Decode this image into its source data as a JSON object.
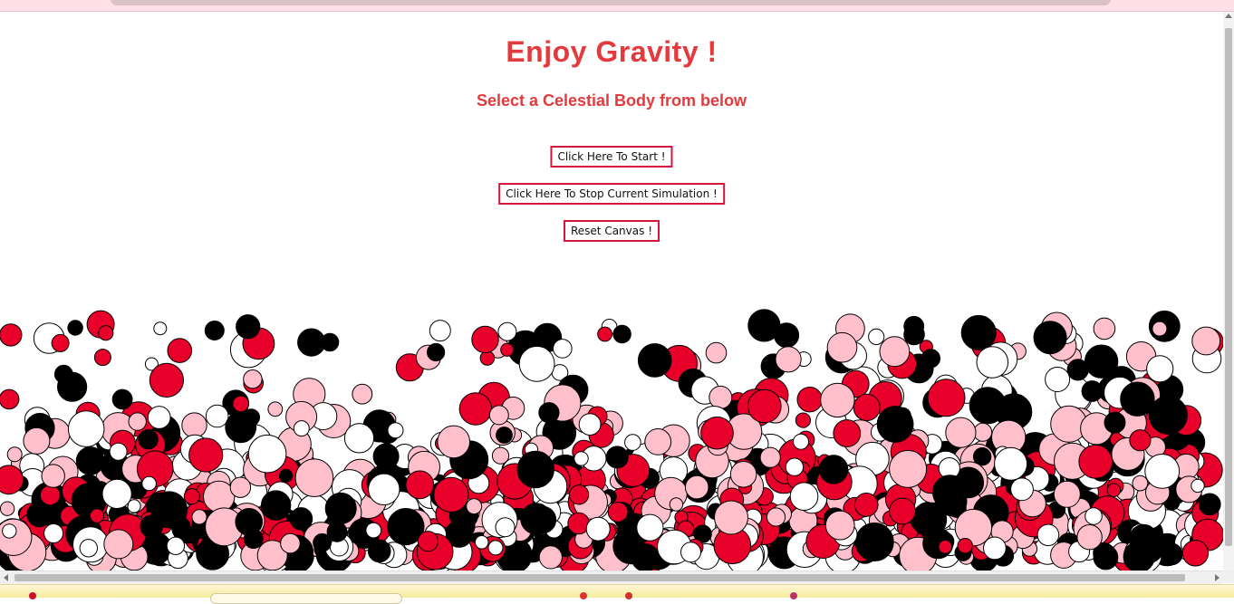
{
  "page": {
    "title": "Enjoy Gravity !",
    "subtitle": "Select a Celestial Body from below"
  },
  "buttons": {
    "start_label": "Click Here To Start !",
    "stop_label": "Click Here To Stop Current Simulation !",
    "reset_label": "Reset Canvas !"
  },
  "colors": {
    "heading": "#e53a3d",
    "button_border": "#d4163a",
    "body_red": "#e8002a",
    "body_pink": "#ffc0cb",
    "body_black": "#000000",
    "body_white": "#ffffff"
  },
  "simulation": {
    "body_colors": [
      "#e8002a",
      "#ffc0cb",
      "#000000",
      "#ffffff"
    ]
  }
}
